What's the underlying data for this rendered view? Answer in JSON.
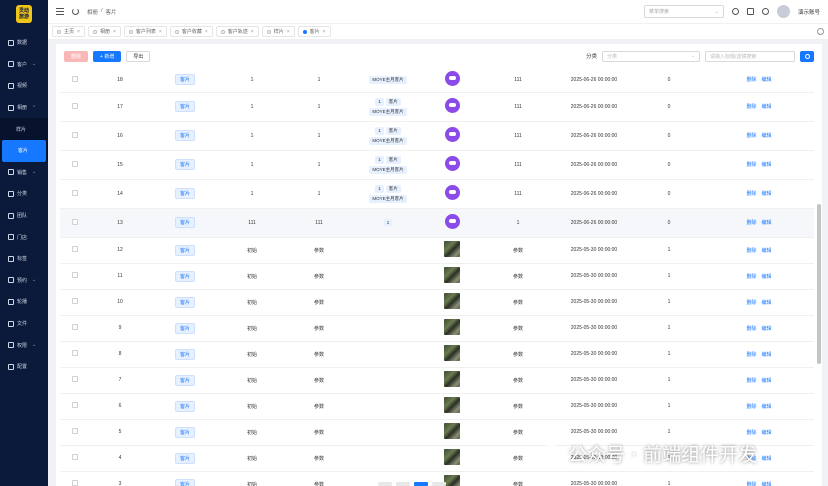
{
  "app": {
    "logo_text": "灵动 旅游"
  },
  "sidebar": {
    "items": [
      {
        "label": "数据",
        "icon": "dashboard-icon"
      },
      {
        "label": "客户",
        "icon": "user-icon",
        "chevron": "⌄"
      },
      {
        "label": "视频",
        "icon": "video-icon"
      },
      {
        "label": "相册",
        "icon": "image-icon",
        "chevron": "⌃"
      }
    ],
    "submenu": [
      {
        "label": "样片"
      },
      {
        "label": "客片",
        "active": true
      }
    ],
    "items2": [
      {
        "label": "销售",
        "icon": "chart-icon",
        "chevron": "⌄"
      },
      {
        "label": "分类",
        "icon": "category-icon"
      },
      {
        "label": "团队",
        "icon": "team-icon"
      },
      {
        "label": "门店",
        "icon": "store-icon"
      },
      {
        "label": "标签",
        "icon": "tag-icon"
      },
      {
        "label": "预约",
        "icon": "calendar-icon",
        "chevron": "⌄"
      },
      {
        "label": "轮播",
        "icon": "carousel-icon"
      },
      {
        "label": "文件",
        "icon": "folder-icon"
      },
      {
        "label": "权限",
        "icon": "permission-icon",
        "chevron": "⌄"
      },
      {
        "label": "配置",
        "icon": "settings-icon"
      }
    ]
  },
  "topbar": {
    "breadcrumb": [
      "相册",
      "/",
      "客片"
    ],
    "search_placeholder": "菜单搜索",
    "user_name": "演示账号"
  },
  "tabs": [
    {
      "label": "主页"
    },
    {
      "label": "相册"
    },
    {
      "label": "客户列表"
    },
    {
      "label": "客户收藏"
    },
    {
      "label": "客户轨迹"
    },
    {
      "label": "样片"
    },
    {
      "label": "客片",
      "active": true
    }
  ],
  "toolbar": {
    "delete_label": "删除",
    "add_label": "+ 新增",
    "export_label": "导出",
    "category_label": "分类",
    "category_placeholder": "分类",
    "keyword_placeholder": "请输入标题/滤镜搜索"
  },
  "table": {
    "rows": [
      {
        "id": "18",
        "tag": "客片",
        "c1": "1",
        "c2": "1",
        "chips": [],
        "chip_text": "MOYE主月客片",
        "img": "purple",
        "c3": "111",
        "date": "2025-06-26 00:00:00",
        "c4": "0",
        "edit": "删除",
        "del": "编辑",
        "kind": "top"
      },
      {
        "id": "17",
        "tag": "客片",
        "c1": "1",
        "c2": "1",
        "chips": [
          "1",
          "客片"
        ],
        "chip_text": "MOYE主月客片",
        "img": "purple",
        "c3": "111",
        "date": "2025-06-26 00:00:00",
        "c4": "0",
        "edit": "删除",
        "del": "编辑"
      },
      {
        "id": "16",
        "tag": "客片",
        "c1": "1",
        "c2": "1",
        "chips": [
          "1",
          "客片"
        ],
        "chip_text": "MOYE主月客片",
        "img": "purple",
        "c3": "111",
        "date": "2025-06-26 00:00:00",
        "c4": "0",
        "edit": "删除",
        "del": "编辑"
      },
      {
        "id": "15",
        "tag": "客片",
        "c1": "1",
        "c2": "1",
        "chips": [
          "1",
          "客片"
        ],
        "chip_text": "MOYE主月客片",
        "img": "purple",
        "c3": "111",
        "date": "2025-06-26 00:00:00",
        "c4": "0",
        "edit": "删除",
        "del": "编辑"
      },
      {
        "id": "14",
        "tag": "客片",
        "c1": "1",
        "c2": "1",
        "chips": [
          "1",
          "客片"
        ],
        "chip_text": "MOYE主月客片",
        "img": "purple",
        "c3": "111",
        "date": "2025-06-26 00:00:00",
        "c4": "0",
        "edit": "删除",
        "del": "编辑"
      },
      {
        "id": "13",
        "tag": "客片",
        "c1": "111",
        "c2": "111",
        "chips": [
          "1"
        ],
        "chip_text": "",
        "img": "purple",
        "c3": "1",
        "date": "2025-06-26 00:00:00",
        "c4": "0",
        "edit": "删除",
        "del": "编辑",
        "kind": "hl"
      },
      {
        "id": "12",
        "tag": "客片",
        "c1": "初始",
        "c2": "参数",
        "chips": [],
        "chip_text": "",
        "img": "photo",
        "c3": "参数",
        "date": "2025-05-30 00:00:00",
        "c4": "1",
        "edit": "删除",
        "del": "编辑",
        "kind": "short"
      },
      {
        "id": "11",
        "tag": "客片",
        "c1": "初始",
        "c2": "参数",
        "chips": [],
        "chip_text": "",
        "img": "photo",
        "c3": "参数",
        "date": "2025-05-30 00:00:00",
        "c4": "1",
        "edit": "删除",
        "del": "编辑",
        "kind": "short"
      },
      {
        "id": "10",
        "tag": "客片",
        "c1": "初始",
        "c2": "参数",
        "chips": [],
        "chip_text": "",
        "img": "photo",
        "c3": "参数",
        "date": "2025-05-30 00:00:00",
        "c4": "1",
        "edit": "删除",
        "del": "编辑",
        "kind": "short"
      },
      {
        "id": "9",
        "tag": "客片",
        "c1": "初始",
        "c2": "参数",
        "chips": [],
        "chip_text": "",
        "img": "photo",
        "c3": "参数",
        "date": "2025-05-30 00:00:00",
        "c4": "1",
        "edit": "删除",
        "del": "编辑",
        "kind": "short"
      },
      {
        "id": "8",
        "tag": "客片",
        "c1": "初始",
        "c2": "参数",
        "chips": [],
        "chip_text": "",
        "img": "photo",
        "c3": "参数",
        "date": "2025-05-30 00:00:00",
        "c4": "1",
        "edit": "删除",
        "del": "编辑",
        "kind": "short"
      },
      {
        "id": "7",
        "tag": "客片",
        "c1": "初始",
        "c2": "参数",
        "chips": [],
        "chip_text": "",
        "img": "photo",
        "c3": "参数",
        "date": "2025-05-30 00:00:00",
        "c4": "1",
        "edit": "删除",
        "del": "编辑",
        "kind": "short"
      },
      {
        "id": "6",
        "tag": "客片",
        "c1": "初始",
        "c2": "参数",
        "chips": [],
        "chip_text": "",
        "img": "photo",
        "c3": "参数",
        "date": "2025-05-30 00:00:00",
        "c4": "1",
        "edit": "删除",
        "del": "编辑",
        "kind": "short"
      },
      {
        "id": "5",
        "tag": "客片",
        "c1": "初始",
        "c2": "参数",
        "chips": [],
        "chip_text": "",
        "img": "photo",
        "c3": "参数",
        "date": "2025-05-30 00:00:00",
        "c4": "1",
        "edit": "删除",
        "del": "编辑",
        "kind": "short"
      },
      {
        "id": "4",
        "tag": "客片",
        "c1": "初始",
        "c2": "参数",
        "chips": [],
        "chip_text": "",
        "img": "photo",
        "c3": "参数",
        "date": "2025-05-30 00:00:00",
        "c4": "1",
        "edit": "删除",
        "del": "编辑",
        "kind": "short"
      },
      {
        "id": "3",
        "tag": "客片",
        "c1": "初始",
        "c2": "参数",
        "chips": [],
        "chip_text": "",
        "img": "photo",
        "c3": "参数",
        "date": "2025-05-30 00:00:00",
        "c4": "1",
        "edit": "删除",
        "del": "编辑",
        "kind": "short"
      }
    ]
  },
  "watermark": {
    "text": "公众号 · 前端组件开发"
  }
}
